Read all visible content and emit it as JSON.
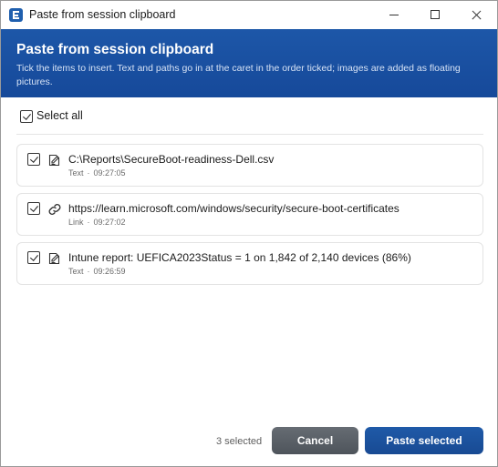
{
  "window": {
    "title": "Paste from session clipboard",
    "controls": {
      "minimize": "minimize-icon",
      "maximize": "maximize-icon",
      "close": "close-icon"
    }
  },
  "header": {
    "title": "Paste from session clipboard",
    "description": "Tick the items to insert. Text and paths go in at the caret in the order ticked; images are added as floating pictures."
  },
  "select_all": {
    "label": "Select all",
    "checked": true
  },
  "items": [
    {
      "icon": "edit-text-icon",
      "main": "C:\\Reports\\SecureBoot-readiness-Dell.csv",
      "kind": "Text",
      "time": "09:27:05",
      "separator": "·",
      "checked": true
    },
    {
      "icon": "link-icon",
      "main": "https://learn.microsoft.com/windows/security/secure-boot-certificates",
      "kind": "Link",
      "time": "09:27:02",
      "separator": "·",
      "checked": true
    },
    {
      "icon": "edit-text-icon",
      "main": "Intune report: UEFICA2023Status = 1 on 1,842 of 2,140 devices (86%)",
      "kind": "Text",
      "time": "09:26:59",
      "separator": "·",
      "checked": true
    }
  ],
  "footer": {
    "selected_count": "3 selected",
    "cancel_label": "Cancel",
    "paste_label": "Paste selected"
  },
  "colors": {
    "header_bg": "#1d57a8",
    "primary_button": "#1f5aa8",
    "secondary_button": "#5a6067"
  }
}
